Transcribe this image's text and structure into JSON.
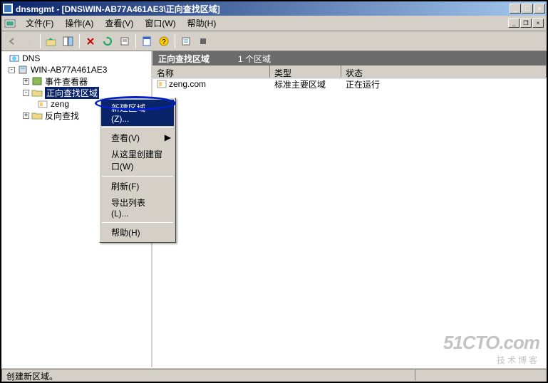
{
  "title": "dnsmgmt - [DNS\\WIN-AB77A461AE3\\正向查找区域]",
  "menu": {
    "file": "文件(F)",
    "action": "操作(A)",
    "view": "查看(V)",
    "window": "窗口(W)",
    "help": "帮助(H)"
  },
  "tree": {
    "root": "DNS",
    "server": "WIN-AB77A461AE3",
    "event_viewer": "事件查看器",
    "forward_zone": "正向查找区域",
    "zone_item": "zeng",
    "reverse_zone": "反向查找"
  },
  "header": {
    "title": "正向查找区域",
    "count": "1 个区域"
  },
  "cols": {
    "name": "名称",
    "type": "类型",
    "status": "状态"
  },
  "row": {
    "name": "zeng.com",
    "type": "标准主要区域",
    "status": "正在运行"
  },
  "ctx": {
    "new_zone": "新建区域(Z)...",
    "view": "查看(V)",
    "new_window": "从这里创建窗口(W)",
    "refresh": "刷新(F)",
    "export": "导出列表(L)...",
    "help": "帮助(H)"
  },
  "status_text": "创建新区域。",
  "watermark": {
    "big": "51CTO.com",
    "small": "技术博客"
  }
}
